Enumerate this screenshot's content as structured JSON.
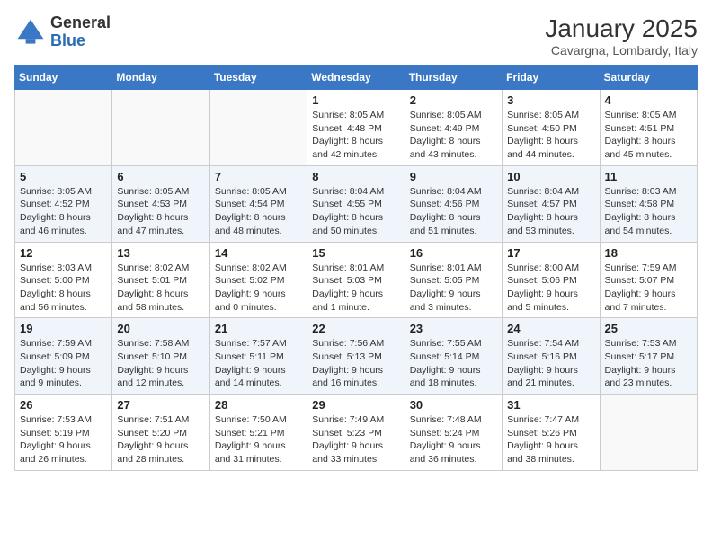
{
  "logo": {
    "general": "General",
    "blue": "Blue"
  },
  "header": {
    "month": "January 2025",
    "location": "Cavargna, Lombardy, Italy"
  },
  "weekdays": [
    "Sunday",
    "Monday",
    "Tuesday",
    "Wednesday",
    "Thursday",
    "Friday",
    "Saturday"
  ],
  "weeks": [
    [
      {
        "day": "",
        "info": ""
      },
      {
        "day": "",
        "info": ""
      },
      {
        "day": "",
        "info": ""
      },
      {
        "day": "1",
        "info": "Sunrise: 8:05 AM\nSunset: 4:48 PM\nDaylight: 8 hours and 42 minutes."
      },
      {
        "day": "2",
        "info": "Sunrise: 8:05 AM\nSunset: 4:49 PM\nDaylight: 8 hours and 43 minutes."
      },
      {
        "day": "3",
        "info": "Sunrise: 8:05 AM\nSunset: 4:50 PM\nDaylight: 8 hours and 44 minutes."
      },
      {
        "day": "4",
        "info": "Sunrise: 8:05 AM\nSunset: 4:51 PM\nDaylight: 8 hours and 45 minutes."
      }
    ],
    [
      {
        "day": "5",
        "info": "Sunrise: 8:05 AM\nSunset: 4:52 PM\nDaylight: 8 hours and 46 minutes."
      },
      {
        "day": "6",
        "info": "Sunrise: 8:05 AM\nSunset: 4:53 PM\nDaylight: 8 hours and 47 minutes."
      },
      {
        "day": "7",
        "info": "Sunrise: 8:05 AM\nSunset: 4:54 PM\nDaylight: 8 hours and 48 minutes."
      },
      {
        "day": "8",
        "info": "Sunrise: 8:04 AM\nSunset: 4:55 PM\nDaylight: 8 hours and 50 minutes."
      },
      {
        "day": "9",
        "info": "Sunrise: 8:04 AM\nSunset: 4:56 PM\nDaylight: 8 hours and 51 minutes."
      },
      {
        "day": "10",
        "info": "Sunrise: 8:04 AM\nSunset: 4:57 PM\nDaylight: 8 hours and 53 minutes."
      },
      {
        "day": "11",
        "info": "Sunrise: 8:03 AM\nSunset: 4:58 PM\nDaylight: 8 hours and 54 minutes."
      }
    ],
    [
      {
        "day": "12",
        "info": "Sunrise: 8:03 AM\nSunset: 5:00 PM\nDaylight: 8 hours and 56 minutes."
      },
      {
        "day": "13",
        "info": "Sunrise: 8:02 AM\nSunset: 5:01 PM\nDaylight: 8 hours and 58 minutes."
      },
      {
        "day": "14",
        "info": "Sunrise: 8:02 AM\nSunset: 5:02 PM\nDaylight: 9 hours and 0 minutes."
      },
      {
        "day": "15",
        "info": "Sunrise: 8:01 AM\nSunset: 5:03 PM\nDaylight: 9 hours and 1 minute."
      },
      {
        "day": "16",
        "info": "Sunrise: 8:01 AM\nSunset: 5:05 PM\nDaylight: 9 hours and 3 minutes."
      },
      {
        "day": "17",
        "info": "Sunrise: 8:00 AM\nSunset: 5:06 PM\nDaylight: 9 hours and 5 minutes."
      },
      {
        "day": "18",
        "info": "Sunrise: 7:59 AM\nSunset: 5:07 PM\nDaylight: 9 hours and 7 minutes."
      }
    ],
    [
      {
        "day": "19",
        "info": "Sunrise: 7:59 AM\nSunset: 5:09 PM\nDaylight: 9 hours and 9 minutes."
      },
      {
        "day": "20",
        "info": "Sunrise: 7:58 AM\nSunset: 5:10 PM\nDaylight: 9 hours and 12 minutes."
      },
      {
        "day": "21",
        "info": "Sunrise: 7:57 AM\nSunset: 5:11 PM\nDaylight: 9 hours and 14 minutes."
      },
      {
        "day": "22",
        "info": "Sunrise: 7:56 AM\nSunset: 5:13 PM\nDaylight: 9 hours and 16 minutes."
      },
      {
        "day": "23",
        "info": "Sunrise: 7:55 AM\nSunset: 5:14 PM\nDaylight: 9 hours and 18 minutes."
      },
      {
        "day": "24",
        "info": "Sunrise: 7:54 AM\nSunset: 5:16 PM\nDaylight: 9 hours and 21 minutes."
      },
      {
        "day": "25",
        "info": "Sunrise: 7:53 AM\nSunset: 5:17 PM\nDaylight: 9 hours and 23 minutes."
      }
    ],
    [
      {
        "day": "26",
        "info": "Sunrise: 7:53 AM\nSunset: 5:19 PM\nDaylight: 9 hours and 26 minutes."
      },
      {
        "day": "27",
        "info": "Sunrise: 7:51 AM\nSunset: 5:20 PM\nDaylight: 9 hours and 28 minutes."
      },
      {
        "day": "28",
        "info": "Sunrise: 7:50 AM\nSunset: 5:21 PM\nDaylight: 9 hours and 31 minutes."
      },
      {
        "day": "29",
        "info": "Sunrise: 7:49 AM\nSunset: 5:23 PM\nDaylight: 9 hours and 33 minutes."
      },
      {
        "day": "30",
        "info": "Sunrise: 7:48 AM\nSunset: 5:24 PM\nDaylight: 9 hours and 36 minutes."
      },
      {
        "day": "31",
        "info": "Sunrise: 7:47 AM\nSunset: 5:26 PM\nDaylight: 9 hours and 38 minutes."
      },
      {
        "day": "",
        "info": ""
      }
    ]
  ]
}
